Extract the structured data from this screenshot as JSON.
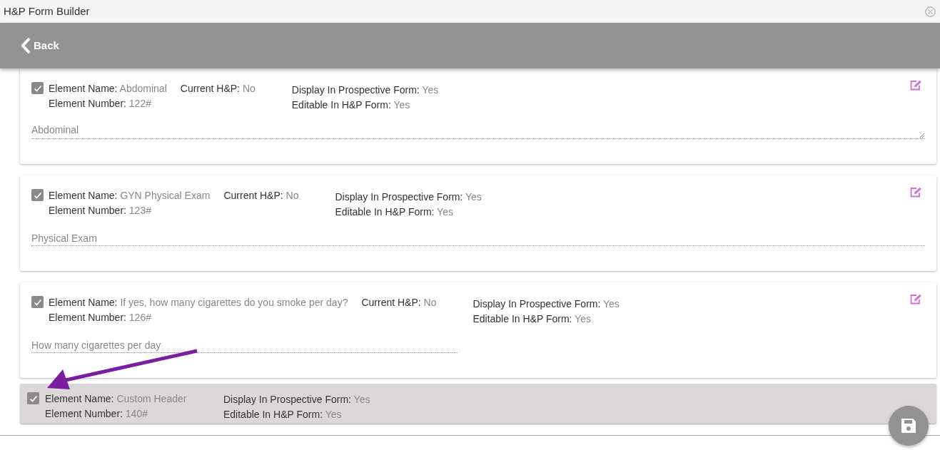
{
  "window": {
    "title": "H&P Form Builder"
  },
  "header": {
    "back_label": "Back"
  },
  "elements": [
    {
      "kind": "card",
      "checked": true,
      "name_label": "Element Name:",
      "name": "Abdominal",
      "number_label": "Element Number:",
      "number": "122#",
      "current_label": "Current H&P:",
      "current": "No",
      "display_label": "Display In Prospective Form:",
      "display": "Yes",
      "editable_label": "Editable In H&P Form:",
      "editable": "Yes",
      "field": {
        "kind": "textarea",
        "wide": true,
        "placeholder": "Abdominal"
      }
    },
    {
      "kind": "card",
      "checked": true,
      "name_label": "Element Name:",
      "name": "GYN Physical Exam",
      "number_label": "Element Number:",
      "number": "123#",
      "current_label": "Current H&P:",
      "current": "No",
      "display_label": "Display In Prospective Form:",
      "display": "Yes",
      "editable_label": "Editable In H&P Form:",
      "editable": "Yes",
      "field": {
        "kind": "input",
        "wide": true,
        "placeholder": "Physical Exam"
      }
    },
    {
      "kind": "card",
      "checked": true,
      "name_label": "Element Name:",
      "name": "If yes, how many cigarettes do you smoke per day?",
      "number_label": "Element Number:",
      "number": "126#",
      "current_label": "Current H&P:",
      "current": "No",
      "display_label": "Display In Prospective Form:",
      "display": "Yes",
      "editable_label": "Editable In H&P Form:",
      "editable": "Yes",
      "field": {
        "kind": "input",
        "wide": false,
        "placeholder": "How many cigarettes per day"
      }
    },
    {
      "kind": "header",
      "checked": true,
      "name_label": "Element Name:",
      "name": "Custom Header",
      "number_label": "Element Number:",
      "number": "140#",
      "display_label": "Display In Prospective Form:",
      "display": "Yes",
      "editable_label": "Editable In H&P Form:",
      "editable": "Yes"
    }
  ]
}
